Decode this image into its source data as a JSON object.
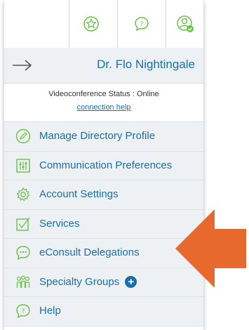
{
  "colors": {
    "accent": "#1a6fa6",
    "icon_green": "#6cc04a",
    "arrow": "#e8692e"
  },
  "header": {
    "icons": [
      "star-icon",
      "chat-icon",
      "profile-icon"
    ]
  },
  "user": {
    "name": "Dr. Flo Nightingale"
  },
  "status": {
    "line": "Videoconference Status : Online",
    "help_link": "connection help"
  },
  "menu": [
    {
      "label": "Manage Directory Profile",
      "icon": "pencil-icon"
    },
    {
      "label": "Communication Preferences",
      "icon": "sliders-icon"
    },
    {
      "label": "Account Settings",
      "icon": "gear-icon"
    },
    {
      "label": "Services",
      "icon": "checkbox-icon"
    },
    {
      "label": "eConsult Delegations",
      "icon": "chat-dots-icon"
    },
    {
      "label": "Specialty Groups",
      "icon": "group-icon"
    },
    {
      "label": "Help",
      "icon": "help-chat-icon"
    }
  ]
}
